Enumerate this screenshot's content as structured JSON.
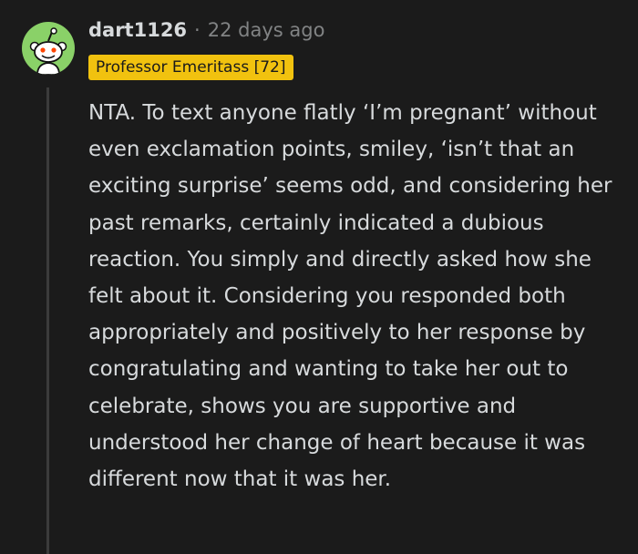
{
  "comment": {
    "author": "dart1126",
    "separator": "·",
    "timestamp": "22 days ago",
    "flair": "Professor Emeritass [72]",
    "avatar": "reddit-snoo-avatar",
    "avatar_color": "#8ad168",
    "body": "NTA. To text anyone flatly ‘I’m pregnant’ without even exclamation points, smiley, ‘isn’t that an exciting surprise’ seems odd, and considering her past remarks, certainly indicated a dubious reaction. You simply and directly asked how she felt about it. Considering you responded both appropriately and positively to her response by congratulating and wanting to take her out to celebrate, shows you are supportive and understood her change of heart because it was different now that it was her."
  },
  "colors": {
    "background": "#1b1b1b",
    "text": "#d7dadc",
    "muted": "#818384",
    "flair_bg": "#f1c20f",
    "thread_line": "#3b3b3b"
  }
}
